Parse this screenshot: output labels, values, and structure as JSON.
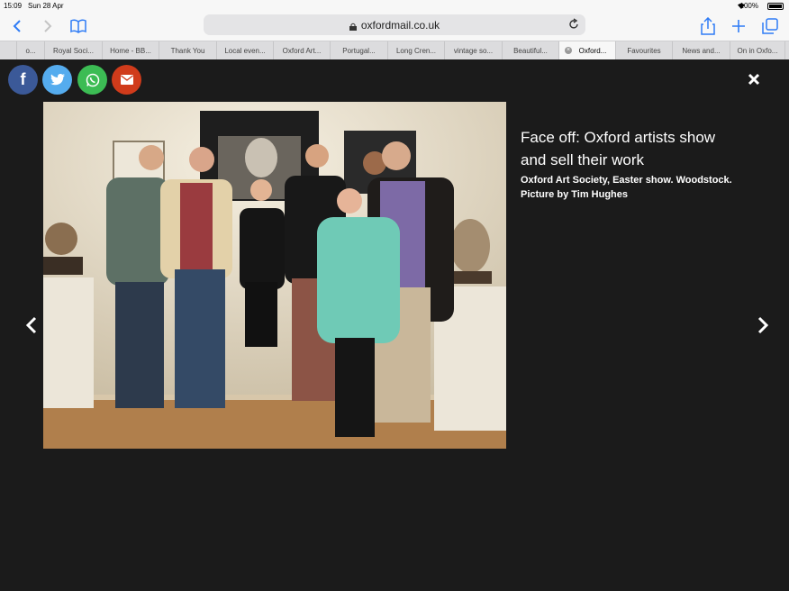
{
  "status": {
    "time": "15:09",
    "date": "Sun 28 Apr",
    "battery": "100%"
  },
  "browser": {
    "url": "oxfordmail.co.uk",
    "tabs": [
      "o...",
      "Royal Soci...",
      "Home - BB...",
      "Thank You",
      "Local even...",
      "Oxford Art...",
      "Portugal...",
      "Long Cren...",
      "vintage so...",
      "Beautiful...",
      "Oxford...",
      "Favourites",
      "News and...",
      "On in Oxfo..."
    ],
    "active_tab": 10
  },
  "share": {
    "facebook": "f",
    "colors": {
      "facebook": "#3b5998",
      "twitter": "#55acee",
      "whatsapp": "#3cbc54",
      "email": "#d03b1b"
    }
  },
  "caption": {
    "title": "Face off: Oxford artists show and sell their work",
    "subtitle": "Oxford Art Society, Easter show. Woodstock. Picture by Tim Hughes"
  }
}
